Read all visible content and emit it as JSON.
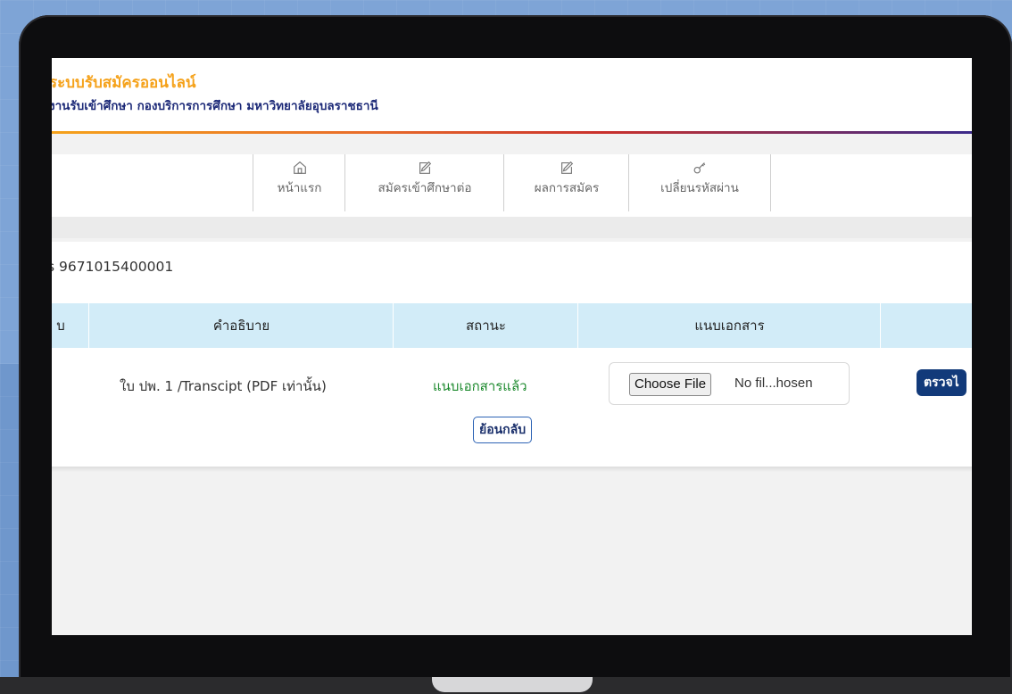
{
  "header": {
    "title": "ระบบรับสมัครออนไลน์",
    "subtitle": "งานรับเข้าศึกษา กองบริการการศึกษา มหาวิทยาลัยอุบลราชธานี"
  },
  "nav": {
    "items": [
      {
        "label": "หน้าแรก",
        "icon": "home-icon"
      },
      {
        "label": "สมัครเข้าศึกษาต่อ",
        "icon": "edit-icon"
      },
      {
        "label": "ผลการสมัคร",
        "icon": "edit-icon"
      },
      {
        "label": "เปลี่ยนรหัสผ่าน",
        "icon": "key-icon"
      }
    ]
  },
  "application": {
    "id_text": "s 9671015400001"
  },
  "table": {
    "headers": [
      "บ",
      "คำอธิบาย",
      "สถานะ",
      "แนบเอกสาร",
      ""
    ],
    "row": {
      "description": "ใบ ปพ. 1 /Transcipt (PDF เท่านั้น)",
      "status": "แนบเอกสารแล้ว",
      "file_button": "Choose File",
      "file_status": "No fil...hosen",
      "check_button": "ตรวจไ"
    }
  },
  "actions": {
    "back_label": "ย้อนกลับ"
  },
  "colors": {
    "title": "#f5a21b",
    "subtitle": "#1d2a78",
    "table_header_bg": "#d2ecf8",
    "status_ok": "#1d8a2e",
    "check_button_bg": "#123a7a"
  }
}
